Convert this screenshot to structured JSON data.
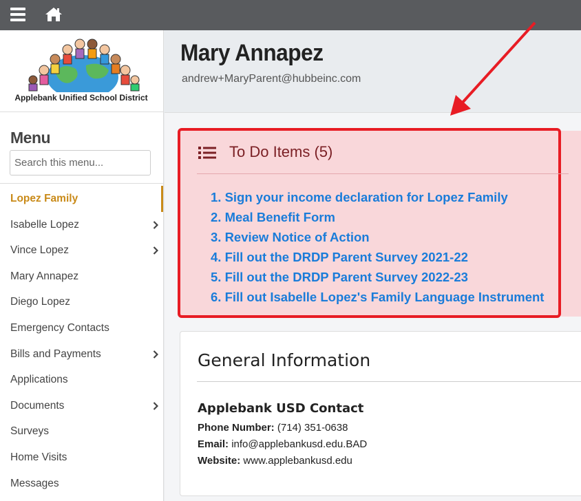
{
  "topbar": {
    "menu_icon": "hamburger-icon",
    "home_icon": "home-icon"
  },
  "logo": {
    "text": "Applebank Unified School District"
  },
  "sidebar": {
    "title": "Menu",
    "search_placeholder": "Search this menu...",
    "items": [
      {
        "label": "Lopez Family",
        "active": true,
        "has_children": false
      },
      {
        "label": "Isabelle Lopez",
        "active": false,
        "has_children": true
      },
      {
        "label": "Vince Lopez",
        "active": false,
        "has_children": true
      },
      {
        "label": "Mary Annapez",
        "active": false,
        "has_children": false
      },
      {
        "label": "Diego Lopez",
        "active": false,
        "has_children": false
      },
      {
        "label": "Emergency Contacts",
        "active": false,
        "has_children": false
      },
      {
        "label": "Bills and Payments",
        "active": false,
        "has_children": true
      },
      {
        "label": "Applications",
        "active": false,
        "has_children": false
      },
      {
        "label": "Documents",
        "active": false,
        "has_children": true
      },
      {
        "label": "Surveys",
        "active": false,
        "has_children": false
      },
      {
        "label": "Home Visits",
        "active": false,
        "has_children": false
      },
      {
        "label": "Messages",
        "active": false,
        "has_children": false
      }
    ]
  },
  "header": {
    "name": "Mary Annapez",
    "email": "andrew+MaryParent@hubbeinc.com"
  },
  "todo": {
    "title": "To Do Items (5)",
    "items": [
      "1. Sign your income declaration for Lopez Family",
      "2. Meal Benefit Form",
      "3. Review Notice of Action",
      "4. Fill out the DRDP Parent Survey 2021-22",
      "5. Fill out the DRDP Parent Survey 2022-23",
      "6. Fill out Isabelle Lopez's Family Language Instrument"
    ]
  },
  "general": {
    "title": "General Information",
    "contact_title": "Applebank USD Contact",
    "phone_label": "Phone Number:",
    "phone": "(714) 351-0638",
    "email_label": "Email:",
    "email": "info@applebankusd.edu.BAD",
    "website_label": "Website:",
    "website": "www.applebankusd.edu"
  },
  "colors": {
    "topbar": "#595b5e",
    "active_menu": "#c98a18",
    "todo_bg": "#f9d7da",
    "todo_border": "#e81c24",
    "todo_link": "#1a7cd9",
    "annotation_arrow": "#e81c24"
  }
}
